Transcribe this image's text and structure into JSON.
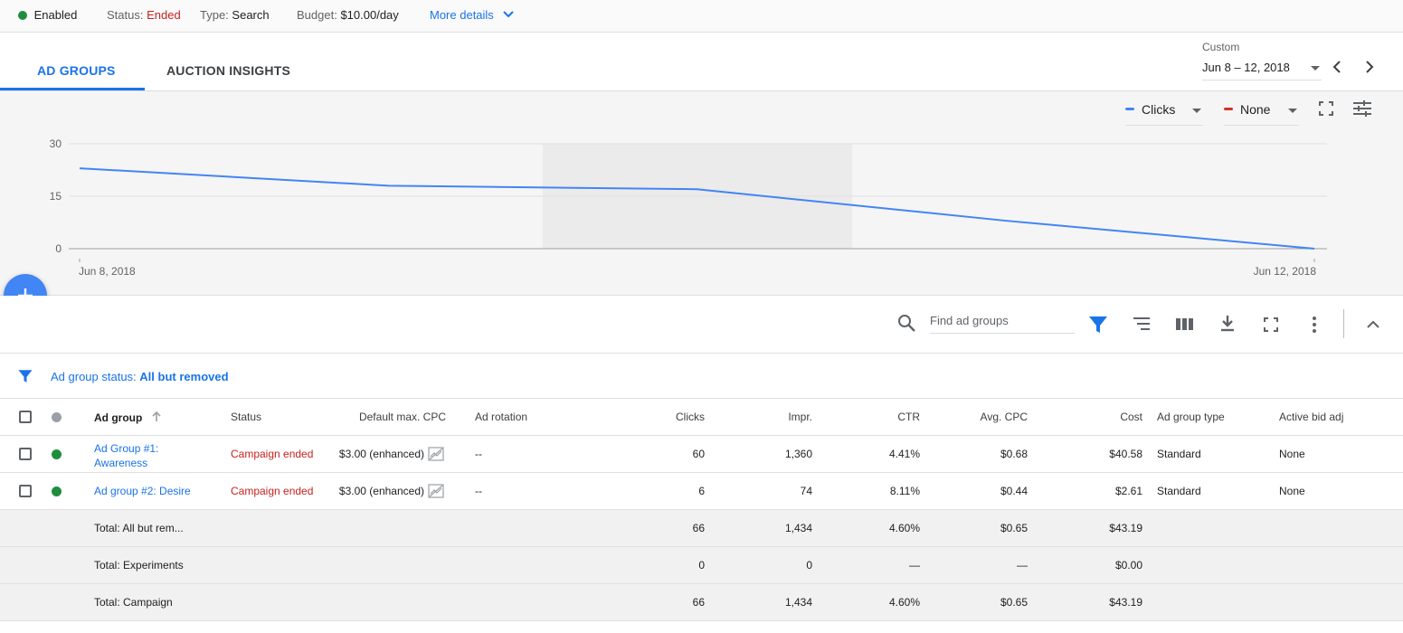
{
  "topbar": {
    "enabled_label": "Enabled",
    "status_label": "Status:",
    "status_value": "Ended",
    "type_label": "Type:",
    "type_value": "Search",
    "budget_label": "Budget:",
    "budget_value": "$10.00/day",
    "more_details": "More details"
  },
  "tabs": [
    {
      "label": "AD GROUPS",
      "active": true
    },
    {
      "label": "AUCTION INSIGHTS",
      "active": false
    }
  ],
  "date_range": {
    "caption": "Custom",
    "value": "Jun 8 – 12, 2018"
  },
  "chart_controls": {
    "metric1": "Clicks",
    "metric1_color": "#4285f4",
    "metric2": "None",
    "metric2_color": "#d93025"
  },
  "chart_data": {
    "type": "line",
    "x": [
      "Jun 8, 2018",
      "Jun 9, 2018",
      "Jun 10, 2018",
      "Jun 11, 2018",
      "Jun 12, 2018"
    ],
    "series": [
      {
        "name": "Clicks",
        "values": [
          23,
          18,
          17,
          8,
          0
        ],
        "color": "#4285f4"
      }
    ],
    "yticks": [
      "0",
      "15",
      "30"
    ],
    "ylim": [
      0,
      30
    ],
    "x_tick_labels": [
      "Jun 8, 2018",
      "Jun 12, 2018"
    ],
    "highlight_range": [
      "Jun 10, 2018",
      "Jun 11, 2018"
    ],
    "grid": true
  },
  "toolbar": {
    "search_placeholder": "Find ad groups"
  },
  "filter": {
    "label": "Ad group status:",
    "value": "All but removed"
  },
  "table": {
    "headers": {
      "ad_group": "Ad group",
      "status": "Status",
      "default_max_cpc": "Default max. CPC",
      "ad_rotation": "Ad rotation",
      "clicks": "Clicks",
      "impr": "Impr.",
      "ctr": "CTR",
      "avg_cpc": "Avg. CPC",
      "cost": "Cost",
      "ad_group_type": "Ad group type",
      "active_bid_adj": "Active bid adj"
    },
    "rows": [
      {
        "ad_group_line1": "Ad Group #1:",
        "ad_group_line2": "Awareness",
        "status": "Campaign ended",
        "default_max_cpc": "$3.00 (enhanced)",
        "ad_rotation": "--",
        "clicks": "60",
        "impr": "1,360",
        "ctr": "4.41%",
        "avg_cpc": "$0.68",
        "cost": "$40.58",
        "ad_group_type": "Standard",
        "active_bid_adj": "None"
      },
      {
        "ad_group_line1": "Ad group #2: Desire",
        "ad_group_line2": "",
        "status": "Campaign ended",
        "default_max_cpc": "$3.00 (enhanced)",
        "ad_rotation": "--",
        "clicks": "6",
        "impr": "74",
        "ctr": "8.11%",
        "avg_cpc": "$0.44",
        "cost": "$2.61",
        "ad_group_type": "Standard",
        "active_bid_adj": "None"
      }
    ],
    "totals": [
      {
        "label": "Total: All but rem...",
        "clicks": "66",
        "impr": "1,434",
        "ctr": "4.60%",
        "avg_cpc": "$0.65",
        "cost": "$43.19"
      },
      {
        "label": "Total: Experiments",
        "clicks": "0",
        "impr": "0",
        "ctr": "—",
        "avg_cpc": "—",
        "cost": "$0.00"
      },
      {
        "label": "Total: Campaign",
        "clicks": "66",
        "impr": "1,434",
        "ctr": "4.60%",
        "avg_cpc": "$0.65",
        "cost": "$43.19"
      }
    ]
  }
}
